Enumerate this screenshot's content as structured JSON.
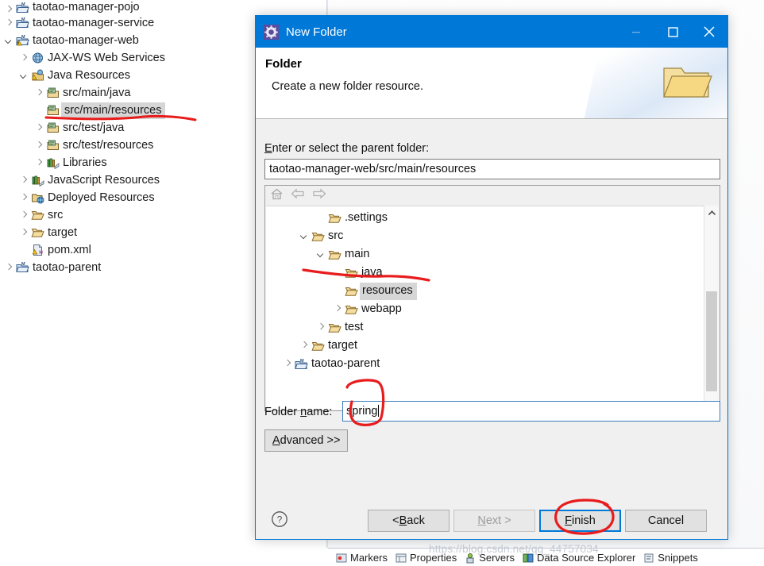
{
  "explorer": {
    "items": [
      {
        "label": "taotao-manager-pojo",
        "indent": 0,
        "twist": "collapsed",
        "icon": "maven-project-icon",
        "selected": false,
        "clipped": true
      },
      {
        "label": "taotao-manager-service",
        "indent": 0,
        "twist": "collapsed",
        "icon": "maven-project-icon",
        "selected": false
      },
      {
        "label": "taotao-manager-web",
        "indent": 0,
        "twist": "expanded",
        "icon": "maven-project-warning-icon",
        "selected": false
      },
      {
        "label": "JAX-WS Web Services",
        "indent": 1,
        "twist": "collapsed",
        "icon": "jaxws-icon",
        "selected": false
      },
      {
        "label": "Java Resources",
        "indent": 1,
        "twist": "expanded",
        "icon": "java-resources-icon",
        "selected": false
      },
      {
        "label": "src/main/java",
        "indent": 2,
        "twist": "collapsed",
        "icon": "source-folder-icon",
        "selected": false
      },
      {
        "label": "src/main/resources",
        "indent": 2,
        "twist": "none",
        "icon": "source-folder-icon",
        "selected": true
      },
      {
        "label": "src/test/java",
        "indent": 2,
        "twist": "collapsed",
        "icon": "source-folder-icon",
        "selected": false
      },
      {
        "label": "src/test/resources",
        "indent": 2,
        "twist": "collapsed",
        "icon": "source-folder-icon",
        "selected": false
      },
      {
        "label": "Libraries",
        "indent": 2,
        "twist": "collapsed",
        "icon": "libraries-icon",
        "selected": false
      },
      {
        "label": "JavaScript Resources",
        "indent": 1,
        "twist": "collapsed",
        "icon": "libraries-icon",
        "selected": false
      },
      {
        "label": "Deployed Resources",
        "indent": 1,
        "twist": "collapsed",
        "icon": "deployed-resources-icon",
        "selected": false
      },
      {
        "label": "src",
        "indent": 1,
        "twist": "collapsed",
        "icon": "folder-icon",
        "selected": false
      },
      {
        "label": "target",
        "indent": 1,
        "twist": "collapsed",
        "icon": "folder-icon",
        "selected": false
      },
      {
        "label": "pom.xml",
        "indent": 1,
        "twist": "none",
        "icon": "pom-xml-icon",
        "selected": false
      },
      {
        "label": "taotao-parent",
        "indent": 0,
        "twist": "collapsed",
        "icon": "maven-project-icon",
        "selected": false
      }
    ]
  },
  "bottom_tabs": [
    {
      "label": "Markers",
      "icon": "markers-icon"
    },
    {
      "label": "Properties",
      "icon": "properties-icon"
    },
    {
      "label": "Servers",
      "icon": "servers-icon"
    },
    {
      "label": "Data Source Explorer",
      "icon": "datasource-icon"
    },
    {
      "label": "Snippets",
      "icon": "snippets-icon"
    }
  ],
  "watermark": "https://blog.csdn.net/qq_44757034",
  "dialog": {
    "title": "New Folder",
    "title_icon": "eclipse-gear-icon",
    "window_buttons": {
      "minimize": "minimize-icon",
      "maximize": "maximize-icon",
      "close": "close-icon"
    },
    "header": {
      "heading": "Folder",
      "description": "Create a new folder resource.",
      "banner_icon": "folder-banner-icon"
    },
    "parent_folder": {
      "label": "Enter or select the parent folder:",
      "label_mnemonic": "E",
      "value": "taotao-manager-web/src/main/resources"
    },
    "tree_toolbar": [
      {
        "icon": "home-icon",
        "enabled": false
      },
      {
        "icon": "back-icon",
        "enabled": false
      },
      {
        "icon": "forward-icon",
        "enabled": false
      }
    ],
    "tree": [
      {
        "label": ".settings",
        "indent": 1,
        "twist": "none",
        "selected": false,
        "icon": "folder-icon"
      },
      {
        "label": "src",
        "indent": 0,
        "twist": "expanded",
        "selected": false,
        "icon": "folder-icon"
      },
      {
        "label": "main",
        "indent": 1,
        "twist": "expanded",
        "selected": false,
        "icon": "folder-icon"
      },
      {
        "label": "java",
        "indent": 2,
        "twist": "none",
        "selected": false,
        "icon": "folder-icon"
      },
      {
        "label": "resources",
        "indent": 2,
        "twist": "none",
        "selected": true,
        "icon": "folder-icon"
      },
      {
        "label": "webapp",
        "indent": 2,
        "twist": "collapsed",
        "selected": false,
        "icon": "folder-icon"
      },
      {
        "label": "test",
        "indent": 1,
        "twist": "collapsed",
        "selected": false,
        "icon": "folder-icon"
      },
      {
        "label": "target",
        "indent": 0,
        "twist": "collapsed",
        "selected": false,
        "icon": "folder-icon"
      },
      {
        "label": "taotao-parent",
        "indent": -1,
        "twist": "collapsed",
        "selected": false,
        "icon": "maven-project-icon"
      }
    ],
    "folder_name": {
      "label_before": "Folder ",
      "label_mnemonic": "n",
      "label_after": "ame:",
      "value": "spring"
    },
    "advanced_button": {
      "mnemonic": "A",
      "rest": "dvanced >>"
    },
    "footer": {
      "help_icon": "help-icon",
      "buttons": [
        {
          "id": "back",
          "prefix": "< ",
          "mnemonic": "B",
          "rest": "ack",
          "state": "enabled"
        },
        {
          "id": "next",
          "prefix": "",
          "mnemonic": "N",
          "rest": "ext >",
          "state": "disabled"
        },
        {
          "id": "finish",
          "prefix": "",
          "mnemonic": "F",
          "rest": "inish",
          "state": "default"
        },
        {
          "id": "cancel",
          "prefix": "",
          "mnemonic": "",
          "rest": "Cancel",
          "state": "enabled"
        }
      ]
    }
  },
  "annotations": {
    "color": "#e81c1c",
    "marks": [
      {
        "name": "underline-src-main-resources",
        "type": "underline"
      },
      {
        "name": "underline-tree-resources",
        "type": "underline"
      },
      {
        "name": "circle-folder-name-value",
        "type": "circle"
      },
      {
        "name": "circle-finish-button",
        "type": "circle"
      }
    ]
  }
}
